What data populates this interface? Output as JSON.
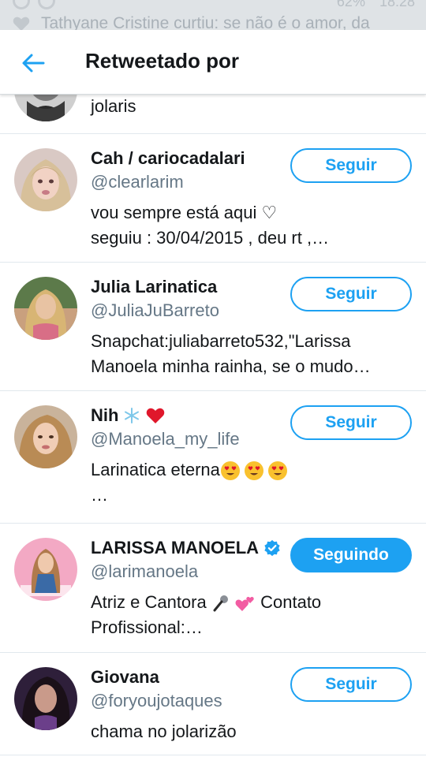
{
  "status_bar": {
    "notification": "Tathyane Cristine curtiu: se não é o amor, da",
    "time": "18:28",
    "battery": "62%"
  },
  "header": {
    "title": "Retweetado por",
    "back_icon": "arrow-left-icon"
  },
  "partial_row": {
    "bio": "jolaris"
  },
  "users": [
    {
      "name": "Cah / cariocadalari",
      "handle": "@clearlarim",
      "bio_lines": [
        "vou sempre está aqui ♡",
        "seguiu : 30/04/2015 , deu rt ,…"
      ],
      "button": "Seguir",
      "following": false
    },
    {
      "name": "Julia Larinatica",
      "handle": "@JuliaJuBarreto",
      "bio_lines": [
        "Snapchat:juliabarreto532,\"Larissa",
        "Manoela minha rainha, se o mudo…"
      ],
      "button": "Seguir",
      "following": false
    },
    {
      "name": "Nih",
      "name_emoji": [
        "snowflake",
        "red-heart"
      ],
      "handle": "@Manoela_my_life",
      "bio_lines": [
        "Larinatica eterna",
        "…"
      ],
      "bio_emoji": [
        "heart-eyes",
        "heart-eyes",
        "heart-eyes"
      ],
      "button": "Seguir",
      "following": false
    },
    {
      "name": "LARISSA MANOELA",
      "verified": true,
      "handle": "@larimanoela",
      "bio_lines": [
        "Atriz e Cantora",
        "Contato",
        "Profissional:…"
      ],
      "bio_emoji": [
        "microphone",
        "two-hearts"
      ],
      "button": "Seguindo",
      "following": true
    },
    {
      "name": "Giovana",
      "handle": "@foryoujotaques",
      "bio_lines": [
        "chama no jolarizão"
      ],
      "button": "Seguir",
      "following": false
    }
  ],
  "colors": {
    "accent": "#1da1f2",
    "text": "#14171a",
    "secondary_text": "#657786",
    "divider": "#e1e8ed"
  }
}
